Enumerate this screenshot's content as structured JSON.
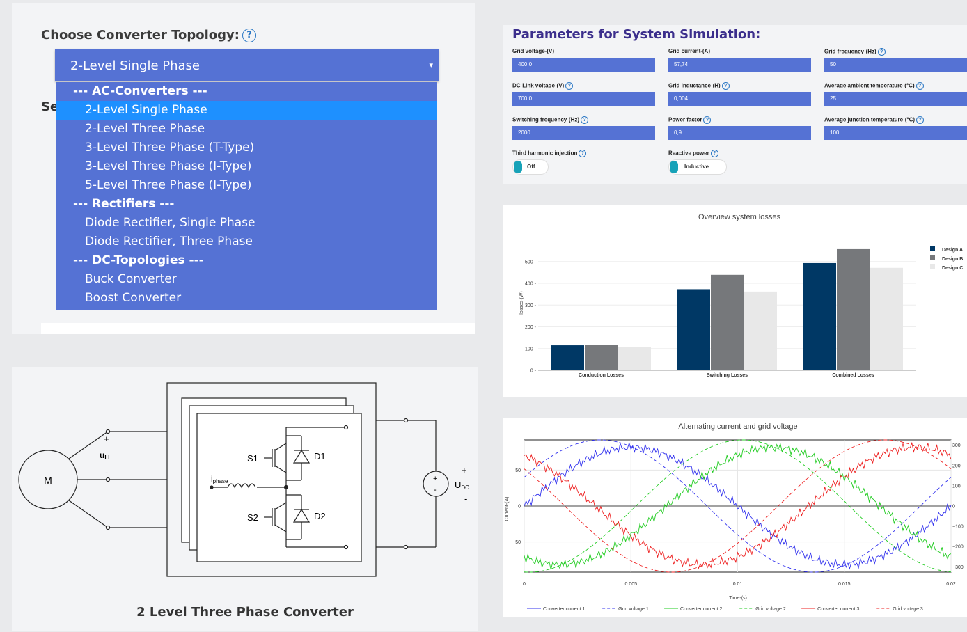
{
  "topology": {
    "label": "Choose Converter Topology:",
    "help": "?",
    "selected": "2-Level Single Phase",
    "arrow": "▾",
    "partial_label": "Se",
    "options": [
      {
        "label": "--- AC-Converters ---",
        "group": true
      },
      {
        "label": "2-Level Single Phase",
        "selected": true
      },
      {
        "label": "2-Level Three Phase"
      },
      {
        "label": "3-Level Three Phase (T-Type)"
      },
      {
        "label": "3-Level Three Phase (I-Type)"
      },
      {
        "label": "5-Level Three Phase (I-Type)"
      },
      {
        "label": "--- Rectifiers ---",
        "group": true
      },
      {
        "label": "Diode Rectifier, Single Phase"
      },
      {
        "label": "Diode Rectifier, Three Phase"
      },
      {
        "label": "--- DC-Topologies ---",
        "group": true
      },
      {
        "label": "Buck Converter"
      },
      {
        "label": "Boost Converter"
      }
    ]
  },
  "params": {
    "title": "Parameters for System Simulation:",
    "fields": [
      {
        "label": "Grid voltage-(V)",
        "value": "400,0",
        "help": false
      },
      {
        "label": "Grid current-(A)",
        "value": "57,74",
        "help": false
      },
      {
        "label": "Grid frequency-(Hz)",
        "value": "50",
        "help": true
      },
      {
        "label": "DC-Link voltage-(V)",
        "value": "700,0",
        "help": true
      },
      {
        "label": "Grid inductance-(H)",
        "value": "0,004",
        "help": true
      },
      {
        "label": "Average ambient temperature-(°C)",
        "value": "25",
        "help": true
      },
      {
        "label": "Switching frequency-(Hz)",
        "value": "2000",
        "help": true
      },
      {
        "label": "Power factor",
        "value": "0,9",
        "help": true
      },
      {
        "label": "Average junction temperature-(°C)",
        "value": "100",
        "help": true
      }
    ],
    "toggles": [
      {
        "label": "Third harmonic injection",
        "value": "Off"
      },
      {
        "label": "Reactive power",
        "value": "Inductive"
      }
    ]
  },
  "circuit": {
    "caption": "2 Level Three Phase Converter",
    "motor_label": "M",
    "u_ll": "u",
    "u_ll_sub": "LL",
    "plus": "+",
    "minus": "-",
    "i_phase": "i",
    "i_phase_sub": "phase",
    "s1": "S1",
    "s2": "S2",
    "d1": "D1",
    "d2": "D2",
    "u_dc": "U",
    "u_dc_sub": "DC"
  },
  "chart_data": [
    {
      "type": "bar",
      "title": "Overview system losses",
      "xlabel": "",
      "ylabel": "losses-(W)",
      "categories": [
        "Conduction Losses",
        "Switching Losses",
        "Combined Losses"
      ],
      "ylim": [
        0,
        560
      ],
      "yticks": [
        0,
        100,
        200,
        300,
        400,
        500
      ],
      "series": [
        {
          "name": "Design A",
          "values": [
            115,
            373,
            493
          ],
          "color": "#003865"
        },
        {
          "name": "Design B",
          "values": [
            116,
            439,
            557
          ],
          "color": "#76787b"
        },
        {
          "name": "Design C",
          "values": [
            106,
            362,
            471
          ],
          "color": "#e8e8e8"
        }
      ],
      "legend": "right",
      "grid": true
    },
    {
      "type": "line",
      "title": "Alternating current and grid voltage",
      "xlabel": "Time-(s)",
      "ylabel": "Current-(A)",
      "xlim": [
        0,
        0.02
      ],
      "ylim": [
        -92,
        92
      ],
      "xticks": [
        0,
        0.005,
        0.01,
        0.015,
        0.02
      ],
      "xtick_labels": [
        "0",
        "0.005",
        "0.01",
        "0.015",
        "0.02"
      ],
      "yticks": [
        -50,
        0,
        50
      ],
      "ytick_labels": [
        "−50",
        "0",
        "50"
      ],
      "y2ticks": [
        300,
        200,
        100,
        0,
        -100,
        -200,
        -300
      ],
      "y2tick_labels": [
        "300",
        "200",
        "100",
        "0",
        "−100",
        "−200",
        "−300"
      ],
      "y2lim": [
        -326.6,
        326.6
      ],
      "series": [
        {
          "name": "Converter current 1",
          "kind": "current",
          "phase_deg": 0,
          "amplitude": 81.6,
          "color": "#3333ee",
          "dash": "solid"
        },
        {
          "name": "Grid voltage 1",
          "kind": "voltage",
          "phase_deg": 25.8,
          "amplitude": 326.6,
          "color": "#3333ee",
          "dash": "dashed"
        },
        {
          "name": "Converter current 2",
          "kind": "current",
          "phase_deg": -120,
          "amplitude": 81.6,
          "color": "#22cc22",
          "dash": "solid"
        },
        {
          "name": "Grid voltage 2",
          "kind": "voltage",
          "phase_deg": -94.2,
          "amplitude": 326.6,
          "color": "#22cc22",
          "dash": "dashed"
        },
        {
          "name": "Converter current 3",
          "kind": "current",
          "phase_deg": 120,
          "amplitude": 81.6,
          "color": "#ee2222",
          "dash": "solid"
        },
        {
          "name": "Grid voltage 3",
          "kind": "voltage",
          "phase_deg": 145.8,
          "amplitude": 326.6,
          "color": "#ee2222",
          "dash": "dashed"
        }
      ],
      "frequency_hz": 50,
      "legend": "bottom",
      "grid": true
    }
  ]
}
